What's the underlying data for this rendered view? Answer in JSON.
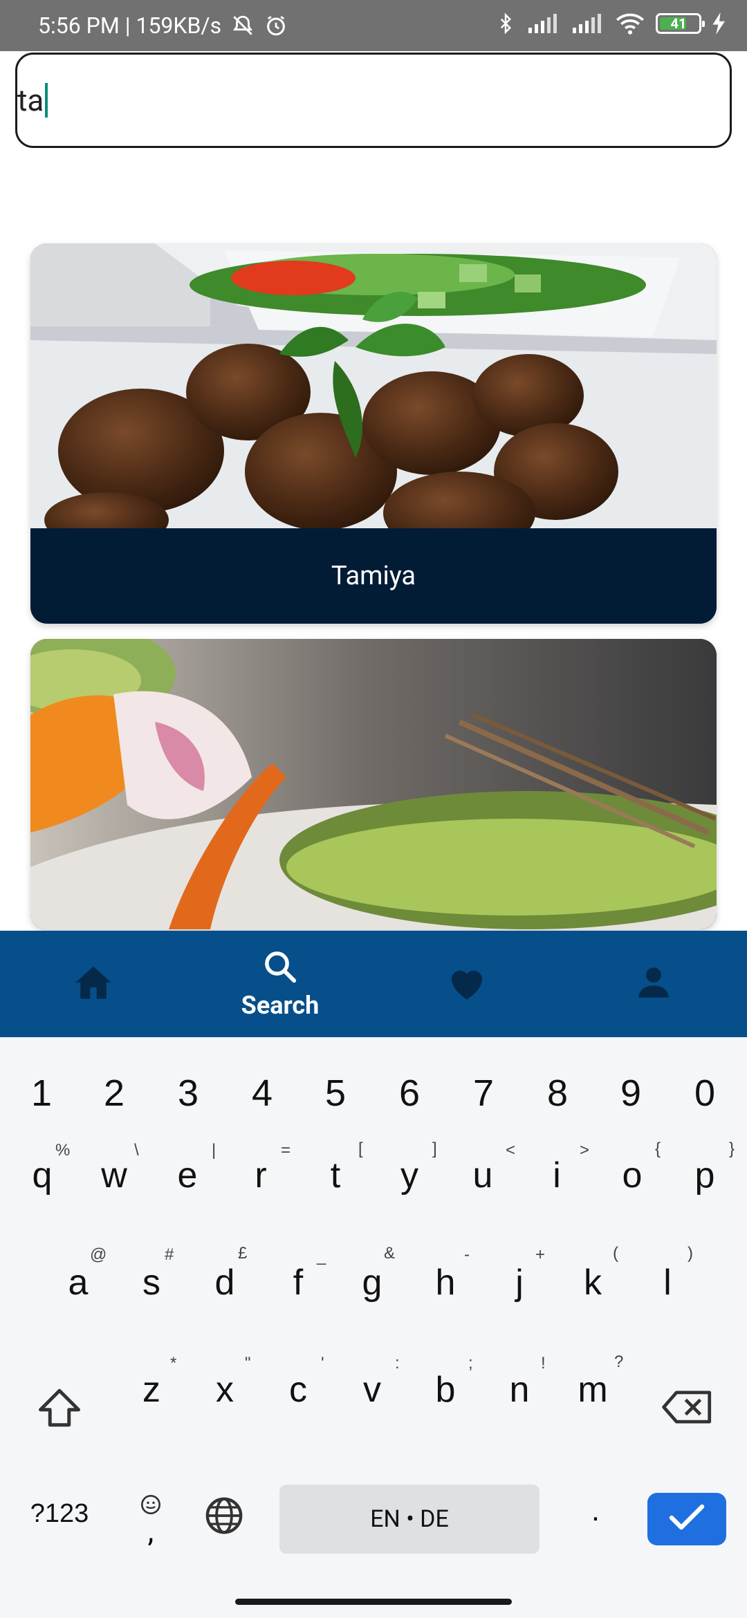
{
  "status_bar": {
    "time_speed": "5:56 PM | 159KB/s",
    "battery": "41",
    "icons": [
      "mute-icon",
      "alarm-icon",
      "bluetooth-icon",
      "signal-icon",
      "signal-icon",
      "wifi-icon",
      "battery-icon",
      "charging-icon"
    ]
  },
  "search": {
    "value": "ta",
    "placeholder": ""
  },
  "results": [
    {
      "title": "Tamiya"
    },
    {
      "title": ""
    }
  ],
  "bottom_nav": {
    "items": [
      {
        "icon": "home-icon",
        "label": ""
      },
      {
        "icon": "search-icon",
        "label": "Search"
      },
      {
        "icon": "heart-icon",
        "label": ""
      },
      {
        "icon": "person-icon",
        "label": ""
      }
    ],
    "active_index": 1
  },
  "keyboard": {
    "numbers": [
      "1",
      "2",
      "3",
      "4",
      "5",
      "6",
      "7",
      "8",
      "9",
      "0"
    ],
    "row1": [
      "q",
      "w",
      "e",
      "r",
      "t",
      "y",
      "u",
      "i",
      "o",
      "p"
    ],
    "row1_sup": [
      "%",
      "\\",
      "|",
      "=",
      "[",
      "]",
      "<",
      ">",
      "{",
      "}"
    ],
    "row2": [
      "a",
      "s",
      "d",
      "f",
      "g",
      "h",
      "j",
      "k",
      "l"
    ],
    "row2_sup": [
      "@",
      "#",
      "£",
      "_",
      "&",
      "-",
      "+",
      "(",
      ")"
    ],
    "row3": [
      "z",
      "x",
      "c",
      "v",
      "b",
      "n",
      "m"
    ],
    "row3_sup": [
      "*",
      "\"",
      "'",
      ":",
      ";",
      "!",
      "?"
    ],
    "symbols_label": "?123",
    "comma": ",",
    "period": ".",
    "space_label": "EN • DE"
  },
  "colors": {
    "nav_bg": "#064f8a",
    "card_caption_bg": "#021c36",
    "nav_active": "#ffffff",
    "nav_inactive": "#05294a",
    "enter_key": "#1f6fe0"
  }
}
